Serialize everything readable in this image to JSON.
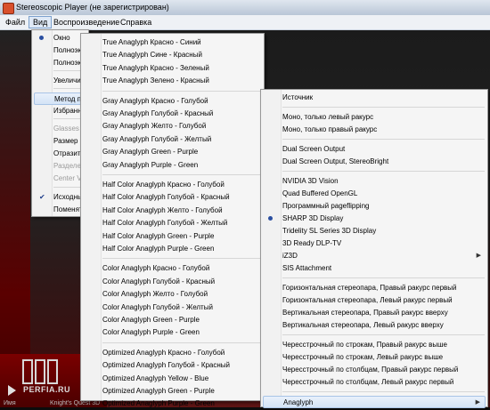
{
  "window": {
    "title": "Stereoscopic Player (не зарегистрирован)"
  },
  "menubar": [
    {
      "label": "Файл"
    },
    {
      "label": "Вид"
    },
    {
      "label": "Воспроизведение"
    },
    {
      "label": "Справка"
    }
  ],
  "view_menu": {
    "items": [
      {
        "label": "Окно",
        "mark": "bullet"
      },
      {
        "label": "Полноэкр"
      },
      {
        "label": "Полноэкр"
      },
      {
        "label": "Увеличит"
      },
      {
        "label": "Метод пр",
        "highlight": true
      },
      {
        "label": "Избранны"
      },
      {
        "label": "Glasses Co",
        "disabled": true
      },
      {
        "label": "Размер (ф"
      },
      {
        "label": "Отразить"
      },
      {
        "label": "Разделен",
        "disabled": true
      },
      {
        "label": "Center Vie",
        "disabled": true
      },
      {
        "label": "Исходный",
        "mark": "check"
      },
      {
        "label": "Поменят"
      }
    ]
  },
  "method_menu": {
    "groups": [
      [
        "True Anaglyph Красно - Синий",
        "True Anaglyph Сине - Красный",
        "True Anaglyph Красно - Зеленый",
        "True Anaglyph Зелено - Красный"
      ],
      [
        "Gray Anaglyph Красно - Голубой",
        "Gray Anaglyph Голубой - Красный",
        "Gray Anaglyph Желто - Голубой",
        "Gray Anaglyph Голубой - Желтый",
        "Gray Anaglyph Green - Purple",
        "Gray Anaglyph Purple - Green"
      ],
      [
        "Half Color Anaglyph Красно - Голубой",
        "Half Color Anaglyph Голубой - Красный",
        "Half Color Anaglyph Желто - Голубой",
        "Half Color Anaglyph Голубой - Желтый",
        "Half Color Anaglyph Green - Purple",
        "Half Color Anaglyph Purple - Green"
      ],
      [
        "Color Anaglyph Красно - Голубой",
        "Color Anaglyph Голубой - Красный",
        "Color Anaglyph Желто - Голубой",
        "Color Anaglyph Голубой - Желтый",
        "Color Anaglyph Green - Purple",
        "Color Anaglyph Purple - Green"
      ],
      [
        "Optimized Anaglyph Красно - Голубой",
        "Optimized Anaglyph Голубой - Красный",
        "Optimized Anaglyph Yellow - Blue",
        "Optimized Anaglyph Green - Purple",
        "Optimized Anaglyph Purple - Green"
      ]
    ]
  },
  "output_menu": {
    "groups": [
      [
        {
          "label": "Источник"
        }
      ],
      [
        {
          "label": "Моно, только левый ракурс"
        },
        {
          "label": "Моно, только правый ракурс"
        }
      ],
      [
        {
          "label": "Dual Screen Output"
        },
        {
          "label": "Dual Screen Output, StereoBright"
        }
      ],
      [
        {
          "label": "NVIDIA 3D Vision"
        },
        {
          "label": "Quad Buffered OpenGL"
        },
        {
          "label": "Программный pageflipping"
        },
        {
          "label": "SHARP 3D Display",
          "selected": true
        },
        {
          "label": "Tridelity SL Series 3D Display"
        },
        {
          "label": "3D Ready DLP-TV"
        },
        {
          "label": "iZ3D",
          "submenu": true
        },
        {
          "label": "SIS Attachment"
        }
      ],
      [
        {
          "label": "Горизонтальная стереопара, Правый ракурс первый"
        },
        {
          "label": "Горизонтальная стереопара, Левый ракурс первый"
        },
        {
          "label": "Вертикальная стереопара, Правый ракурс вверху"
        },
        {
          "label": "Вертикальная стереопара, Левый ракурс вверху"
        }
      ],
      [
        {
          "label": "Чересстрочный по строкам, Правый ракурс выше"
        },
        {
          "label": "Чересстрочный по строкам, Левый ракурс выше"
        },
        {
          "label": "Чересстрочный по столбцам, Правый ракурс первый"
        },
        {
          "label": "Чересстрочный по столбцам, Левый ракурс первый"
        }
      ],
      [
        {
          "label": "Anaglyph",
          "submenu": true,
          "highlight": true
        }
      ]
    ]
  },
  "watermark": {
    "text": "PERFIA.RU"
  },
  "status": {
    "left": "Имя",
    "right": "Knight's Quest 3D"
  },
  "colors": {
    "menu_bg": "#f5f5f5",
    "highlight": "#d3e3f6",
    "mark": "#2a4ea0"
  },
  "icons": {
    "play": "play-icon",
    "check": "check-icon",
    "radio": "radio-bullet-icon",
    "submenu": "chevron-right-icon"
  }
}
